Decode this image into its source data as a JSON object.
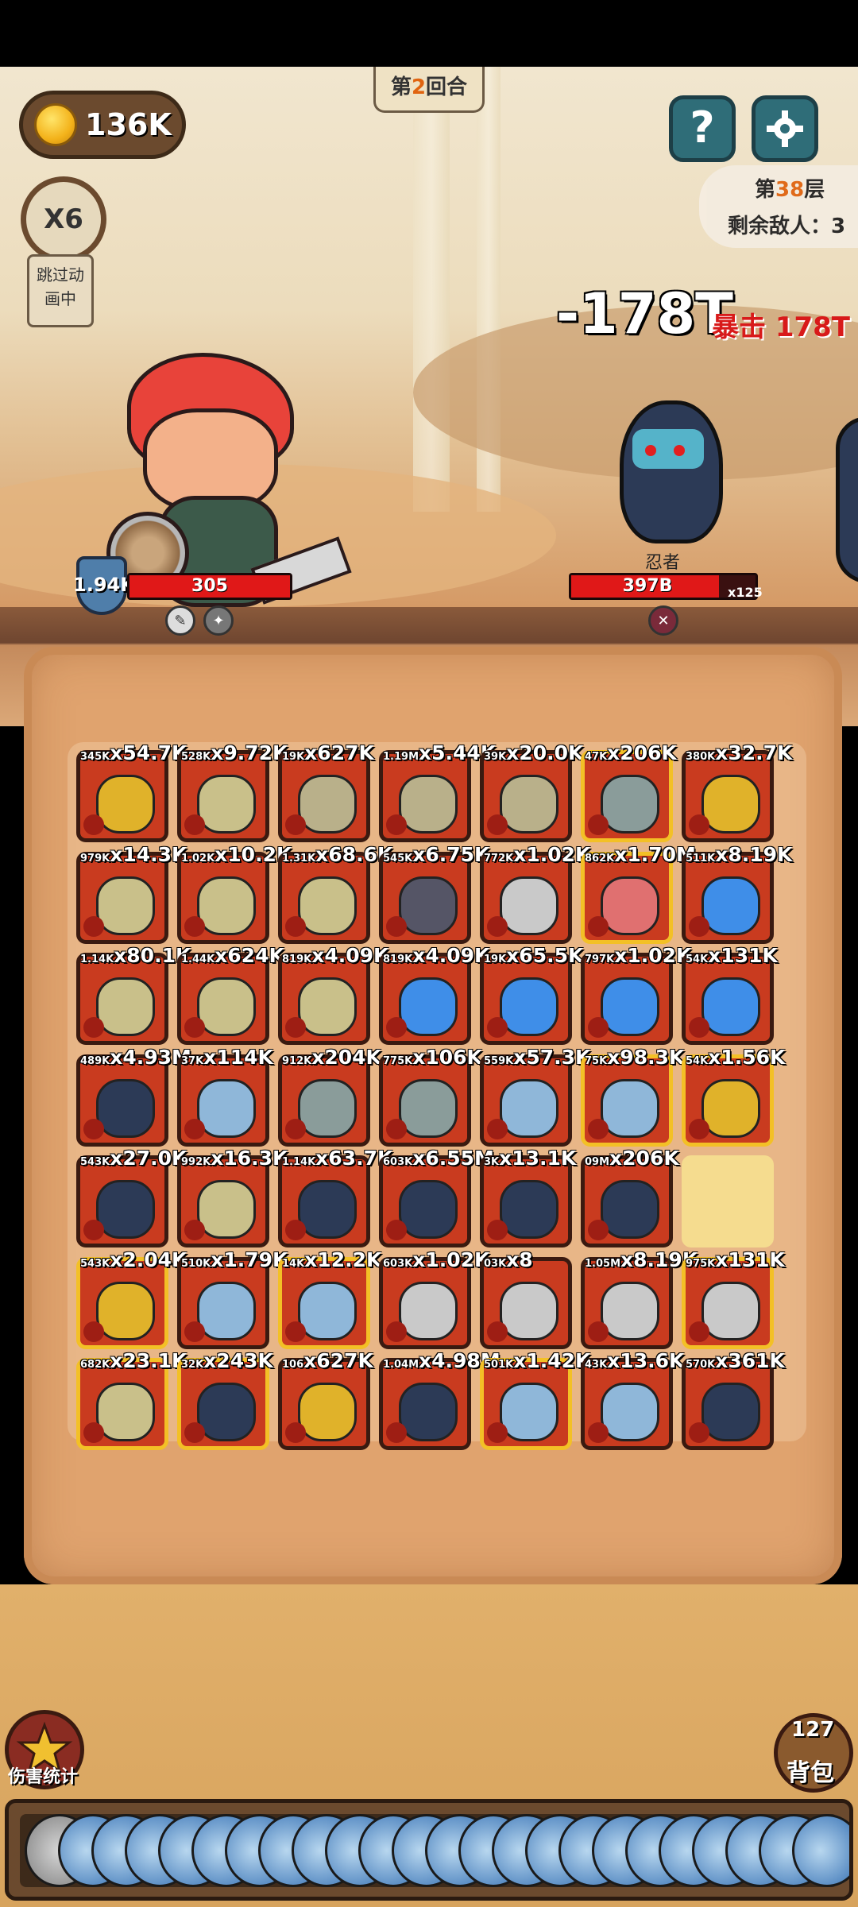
{
  "hud": {
    "coins": "136K",
    "round_prefix": "第",
    "round_num": "2",
    "round_suffix": "回合",
    "speed": "X6",
    "skip_line1": "跳过动",
    "skip_line2": "画中",
    "help": "?",
    "settings_icon": "gear-icon",
    "floor_prefix": "第",
    "floor_num": "38",
    "floor_suffix": "层",
    "enemies_left": "剩余敌人：3"
  },
  "battle": {
    "damage": "-178T",
    "crit": "暴击 178T",
    "hero_armor": "1.94K",
    "hero_hp": "305",
    "hero_hp_fraction": 1.0,
    "enemy_name": "忍者",
    "enemy_hp": "397B",
    "enemy_hp_fraction": 0.8,
    "enemy_multiplier": "x125"
  },
  "colors": {
    "tile_red": "#c93b1f",
    "tile_gold_border": "#f3c026",
    "empty_tile": "#f5dc8f",
    "hp_red": "#e01818",
    "floor_accent": "#e06410"
  },
  "grid": [
    [
      {
        "s": "345K",
        "l": "x54.7K",
        "c": "#e0b22a"
      },
      {
        "s": "528K",
        "l": "x9.72K",
        "c": "#c9c08a"
      },
      {
        "s": "19K",
        "l": "x627K",
        "c": "#b9b08a"
      },
      {
        "s": "1.19M",
        "l": "x5.44K",
        "c": "#b9b08a"
      },
      {
        "s": "39K",
        "l": "x20.0K",
        "c": "#b9b08a"
      },
      {
        "s": "47K",
        "l": "x206K",
        "c": "#8a9c9a",
        "g": 1
      },
      {
        "s": "380K",
        "l": "x32.7K",
        "c": "#e0b22a"
      }
    ],
    [
      {
        "s": "979K",
        "l": "x14.3K",
        "c": "#c9c08a"
      },
      {
        "s": "1.02K",
        "l": "x10.2K",
        "c": "#c9c08a"
      },
      {
        "s": "1.31K",
        "l": "x68.6K",
        "c": "#c9c08a"
      },
      {
        "s": "545K",
        "l": "x6.75K",
        "c": "#555566"
      },
      {
        "s": "772K",
        "l": "x1.02K",
        "c": "#c9c9c9"
      },
      {
        "s": "862K",
        "l": "x1.70M",
        "c": "#e07070",
        "g": 1
      },
      {
        "s": "511K",
        "l": "x8.19K",
        "c": "#3f8ee8"
      }
    ],
    [
      {
        "s": "1.14K",
        "l": "x80.1K",
        "c": "#c9c08a"
      },
      {
        "s": "1.44K",
        "l": "x624K",
        "c": "#c9c08a"
      },
      {
        "s": "819K",
        "l": "x4.09K",
        "c": "#c9c08a"
      },
      {
        "s": "819K",
        "l": "x4.09K",
        "c": "#3f8ee8"
      },
      {
        "s": "19K",
        "l": "x65.5K",
        "c": "#3f8ee8"
      },
      {
        "s": "797K",
        "l": "x1.02K",
        "c": "#3f8ee8"
      },
      {
        "s": "54K",
        "l": "x131K",
        "c": "#3f8ee8"
      }
    ],
    [
      {
        "s": "489K",
        "l": "x4.93M",
        "c": "#2c3a56"
      },
      {
        "s": "37K",
        "l": "x114K",
        "c": "#8fb7d9"
      },
      {
        "s": "912K",
        "l": "x204K",
        "c": "#8a9c9a"
      },
      {
        "s": "775K",
        "l": "x106K",
        "c": "#8a9c9a"
      },
      {
        "s": "559K",
        "l": "x57.3K",
        "c": "#8fb7d9"
      },
      {
        "s": "75K",
        "l": "x98.3K",
        "c": "#8fb7d9",
        "g": 1
      },
      {
        "s": "54K",
        "l": "x1.56K",
        "c": "#e0b22a",
        "g": 1
      }
    ],
    [
      {
        "s": "543K",
        "l": "x27.0K",
        "c": "#2c3a56"
      },
      {
        "s": "992K",
        "l": "x16.3K",
        "c": "#c9c08a"
      },
      {
        "s": "1.14K",
        "l": "x63.7K",
        "c": "#2c3a56"
      },
      {
        "s": "603K",
        "l": "x6.55M",
        "c": "#2c3a56"
      },
      {
        "s": "3K",
        "l": "x13.1K",
        "c": "#2c3a56"
      },
      {
        "s": "09M",
        "l": "x206K",
        "c": "#2c3a56"
      },
      {
        "e": 1
      }
    ],
    [
      {
        "s": "543K",
        "l": "x2.04K",
        "c": "#e0b22a",
        "g": 1
      },
      {
        "s": "510K",
        "l": "x1.79K",
        "c": "#8fb7d9"
      },
      {
        "s": "14K",
        "l": "x12.2K",
        "c": "#8fb7d9",
        "g": 1
      },
      {
        "s": "603K",
        "l": "x1.02K",
        "c": "#c9c9c9"
      },
      {
        "s": "03K",
        "l": "x8",
        "c": "#c9c9c9"
      },
      {
        "s": "1.05M",
        "l": "x8.19K",
        "c": "#c9c9c9"
      },
      {
        "s": "975K",
        "l": "x131K",
        "c": "#c9c9c9",
        "g": 1
      }
    ],
    [
      {
        "s": "682K",
        "l": "x23.1K",
        "c": "#c9c08a",
        "g": 1
      },
      {
        "s": "32K",
        "l": "x243K",
        "c": "#2c3a56",
        "g": 1
      },
      {
        "s": "106",
        "l": "x627K",
        "c": "#e0b22a"
      },
      {
        "s": "1.04M",
        "l": "x4.98M",
        "c": "#2c3a56"
      },
      {
        "s": "501K",
        "l": "x1.42K",
        "c": "#8fb7d9",
        "g": 1
      },
      {
        "s": "43K",
        "l": "x13.6K",
        "c": "#8fb7d9"
      },
      {
        "s": "570K",
        "l": "x361K",
        "c": "#2c3a56"
      }
    ]
  ],
  "bottom": {
    "stats_label": "伤害统计",
    "bag_count": "127",
    "bag_label": "背包",
    "tray_count": 24
  }
}
